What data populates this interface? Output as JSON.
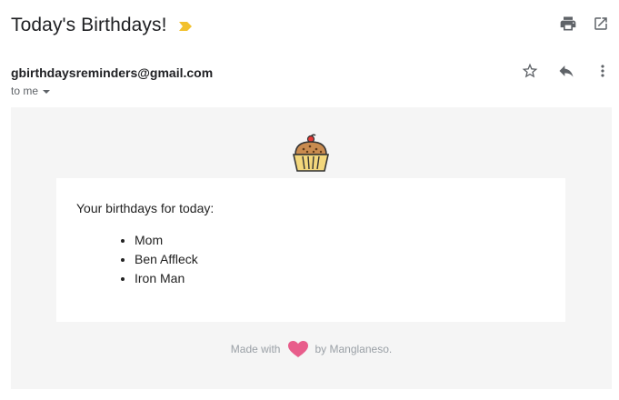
{
  "email": {
    "subject": "Today's Birthdays!",
    "sender": "gbirthdaysreminders@gmail.com",
    "recipient": "to me"
  },
  "icons": {
    "importance": "importance-marker-icon",
    "print": "print-icon",
    "open_new_window": "open-in-new-icon",
    "star": "star-outline-icon",
    "reply": "reply-icon",
    "more": "more-vert-icon",
    "recipient_caret": "caret-down-icon",
    "cupcake": "cupcake-icon",
    "heart": "heart-icon"
  },
  "colors": {
    "importance": "#f2c12e",
    "heart": "#e85d8b",
    "body_bg": "#f5f5f5"
  },
  "body": {
    "intro": "Your birthdays for today:",
    "birthdays": [
      "Mom",
      "Ben Affleck",
      "Iron Man"
    ],
    "footer": {
      "made_with": "Made with",
      "by": "by Manglaneso."
    }
  }
}
